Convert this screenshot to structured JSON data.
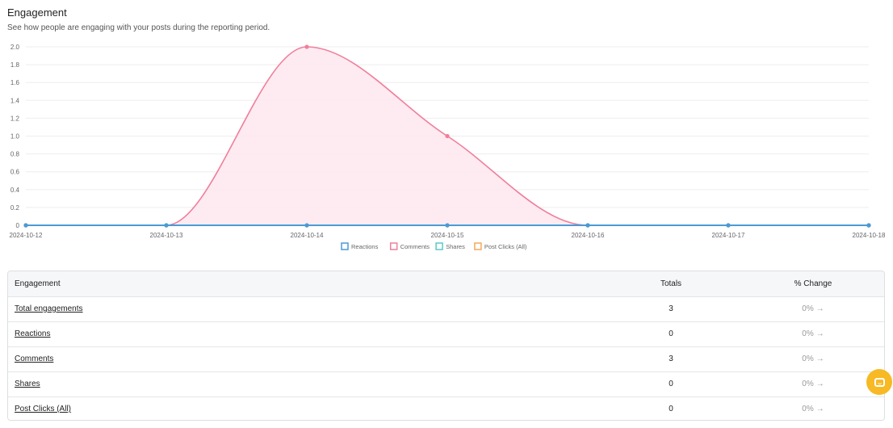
{
  "header": {
    "title": "Engagement",
    "subtitle": "See how people are engaging with your posts during the reporting period."
  },
  "chart_data": {
    "type": "line",
    "x": [
      "2024-10-12",
      "2024-10-13",
      "2024-10-14",
      "2024-10-15",
      "2024-10-16",
      "2024-10-17",
      "2024-10-18"
    ],
    "y_ticks": [
      "0",
      "0.2",
      "0.4",
      "0.6",
      "0.8",
      "1.0",
      "1.2",
      "1.4",
      "1.6",
      "1.8",
      "2.0"
    ],
    "ylim": [
      0,
      2
    ],
    "grid": true,
    "legend_position": "bottom",
    "series": [
      {
        "name": "Reactions",
        "values": [
          0,
          0,
          0,
          0,
          0,
          0,
          0
        ],
        "color": "#4a9bd6"
      },
      {
        "name": "Comments",
        "values": [
          0,
          0,
          2,
          1,
          0,
          0,
          0
        ],
        "color": "#f07f9c",
        "fill": "#fde8ee"
      },
      {
        "name": "Shares",
        "values": [
          0,
          0,
          0,
          0,
          0,
          0,
          0
        ],
        "color": "#5bc9c9"
      },
      {
        "name": "Post Clicks (All)",
        "values": [
          0,
          0,
          0,
          0,
          0,
          0,
          0
        ],
        "color": "#f5a95a"
      }
    ]
  },
  "table": {
    "headers": {
      "engagement": "Engagement",
      "totals": "Totals",
      "change": "% Change"
    },
    "rows": [
      {
        "label": "Total engagements",
        "total": "3",
        "change": "0%"
      },
      {
        "label": "Reactions",
        "total": "0",
        "change": "0%"
      },
      {
        "label": "Comments",
        "total": "3",
        "change": "0%"
      },
      {
        "label": "Shares",
        "total": "0",
        "change": "0%"
      },
      {
        "label": "Post Clicks (All)",
        "total": "0",
        "change": "0%"
      }
    ]
  },
  "icons": {
    "row_change": "arrow-right-icon",
    "chat": "chat-icon"
  }
}
